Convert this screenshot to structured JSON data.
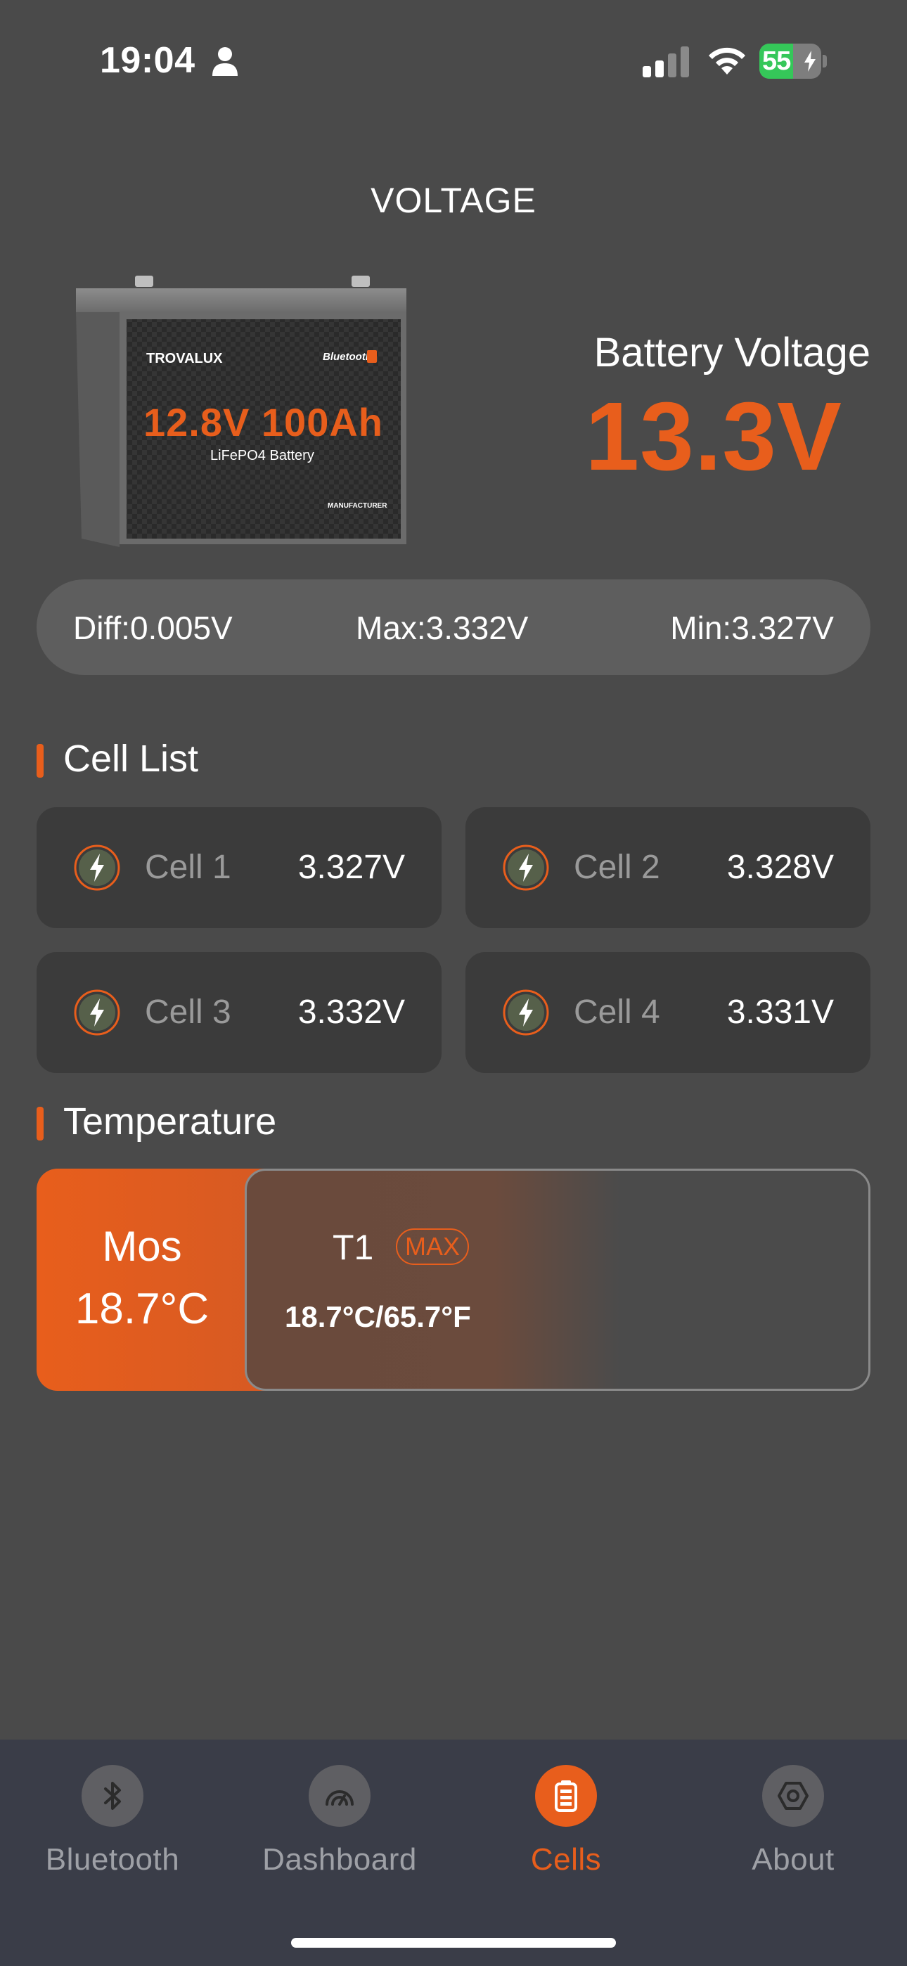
{
  "status_bar": {
    "time": "19:04",
    "battery_level": "55",
    "battery_fill_fraction": 0.55
  },
  "page": {
    "title": "VOLTAGE"
  },
  "battery_image": {
    "brand": "TROVALUX",
    "bluetooth_label": "Bluetooth",
    "spec": "12.8V 100Ah",
    "type": "LiFePO4 Battery",
    "manufacturer": "MANUFACTURER"
  },
  "battery_voltage": {
    "label": "Battery Voltage",
    "value": "13.3V"
  },
  "summary": {
    "diff": "Diff:0.005V",
    "max": "Max:3.332V",
    "min": "Min:3.327V"
  },
  "cell_list": {
    "title": "Cell List",
    "cells": [
      {
        "name": "Cell 1",
        "voltage": "3.327V"
      },
      {
        "name": "Cell 2",
        "voltage": "3.328V"
      },
      {
        "name": "Cell 3",
        "voltage": "3.332V"
      },
      {
        "name": "Cell 4",
        "voltage": "3.331V"
      }
    ]
  },
  "temperature": {
    "title": "Temperature",
    "mos_label": "Mos",
    "mos_value": "18.7°C",
    "sensor_name": "T1",
    "sensor_badge": "MAX",
    "sensor_value": "18.7°C/65.7°F"
  },
  "tabs": [
    {
      "label": "Bluetooth",
      "icon": "bluetooth-icon",
      "active": false
    },
    {
      "label": "Dashboard",
      "icon": "dashboard-icon",
      "active": false
    },
    {
      "label": "Cells",
      "icon": "cells-icon",
      "active": true
    },
    {
      "label": "About",
      "icon": "about-icon",
      "active": false
    }
  ],
  "colors": {
    "accent": "#e85e1c",
    "background": "#4a4a4a",
    "card": "#3b3b3b",
    "tab_bar": "#3a3d48",
    "battery_green": "#35c759"
  }
}
